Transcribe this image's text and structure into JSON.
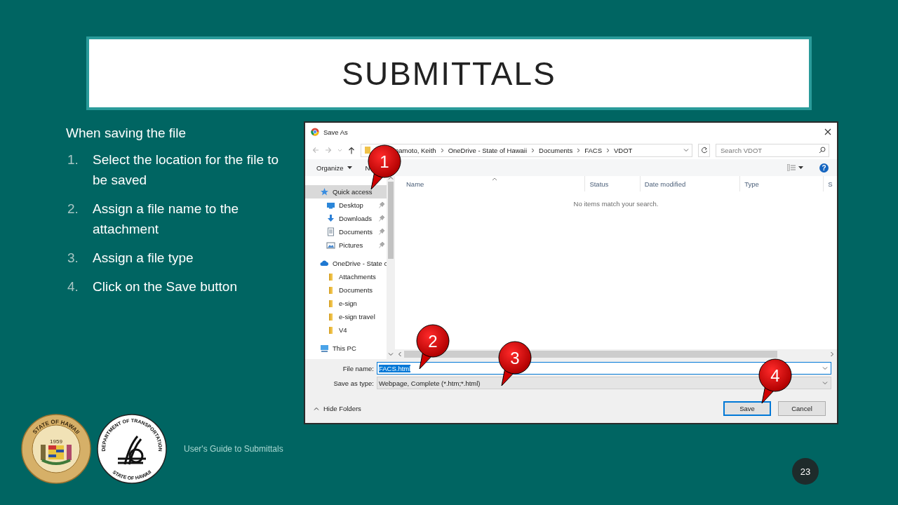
{
  "slide": {
    "title": "SUBMITTALS",
    "intro": "When saving the file",
    "steps": [
      {
        "number": "1.",
        "text": "Select the location for the file to be saved"
      },
      {
        "number": "2.",
        "text": "Assign a file name to the attachment"
      },
      {
        "number": "3.",
        "text": "Assign a file type"
      },
      {
        "number": "4.",
        "text": "Click on the Save button"
      }
    ],
    "footer": "User's Guide to Submittals",
    "page_number": "23"
  },
  "logos": {
    "state_seal": {
      "ring_text": "STATE OF HAWAII",
      "year": "1959"
    },
    "dot_seal": {
      "ring_text": "DEPARTMENT OF TRANSPORTATION",
      "bottom_text": "STATE OF HAWAII"
    }
  },
  "dialog": {
    "title": "Save As",
    "breadcrumb": [
      "namoto, Keith",
      "OneDrive - State of Hawaii",
      "Documents",
      "FACS",
      "VDOT"
    ],
    "search": {
      "placeholder": "Search VDOT"
    },
    "toolbar": {
      "organize": "Organize",
      "new_folder": "N",
      "help": "?"
    },
    "nav": [
      {
        "label": "Quick access",
        "kind": "star",
        "selected": true,
        "children": [
          {
            "label": "Desktop",
            "kind": "desktop",
            "selected": false,
            "pinned": true
          },
          {
            "label": "Downloads",
            "kind": "download",
            "selected": false,
            "pinned": true
          },
          {
            "label": "Documents",
            "kind": "document",
            "selected": false,
            "pinned": true
          },
          {
            "label": "Pictures",
            "kind": "picture",
            "selected": false,
            "pinned": true
          }
        ]
      },
      {
        "label": "OneDrive - State c",
        "kind": "cloud",
        "selected": false,
        "children": [
          {
            "label": "Attachments",
            "kind": "folder",
            "selected": false,
            "pinned": false
          },
          {
            "label": "Documents",
            "kind": "folder",
            "selected": false,
            "pinned": false
          },
          {
            "label": "e-sign",
            "kind": "folder",
            "selected": false,
            "pinned": false
          },
          {
            "label": "e-sign travel",
            "kind": "folder",
            "selected": false,
            "pinned": false
          },
          {
            "label": "V4",
            "kind": "folder",
            "selected": false,
            "pinned": false
          }
        ]
      },
      {
        "label": "This PC",
        "kind": "pc",
        "selected": false
      }
    ],
    "columns": [
      "Name",
      "Status",
      "Date modified",
      "Type",
      "S"
    ],
    "empty_message": "No items match your search.",
    "file_name": {
      "label": "File name:",
      "value": "FACS.html",
      "text_selected": true
    },
    "save_as_type": {
      "label": "Save as type:",
      "value": "Webpage, Complete (*.htm;*.html)"
    },
    "hide_folders": "Hide Folders",
    "buttons": [
      {
        "label": "Save",
        "default": true
      },
      {
        "label": "Cancel",
        "default": false
      }
    ]
  },
  "callouts": [
    {
      "number": "1"
    },
    {
      "number": "2"
    },
    {
      "number": "3"
    },
    {
      "number": "4"
    }
  ]
}
